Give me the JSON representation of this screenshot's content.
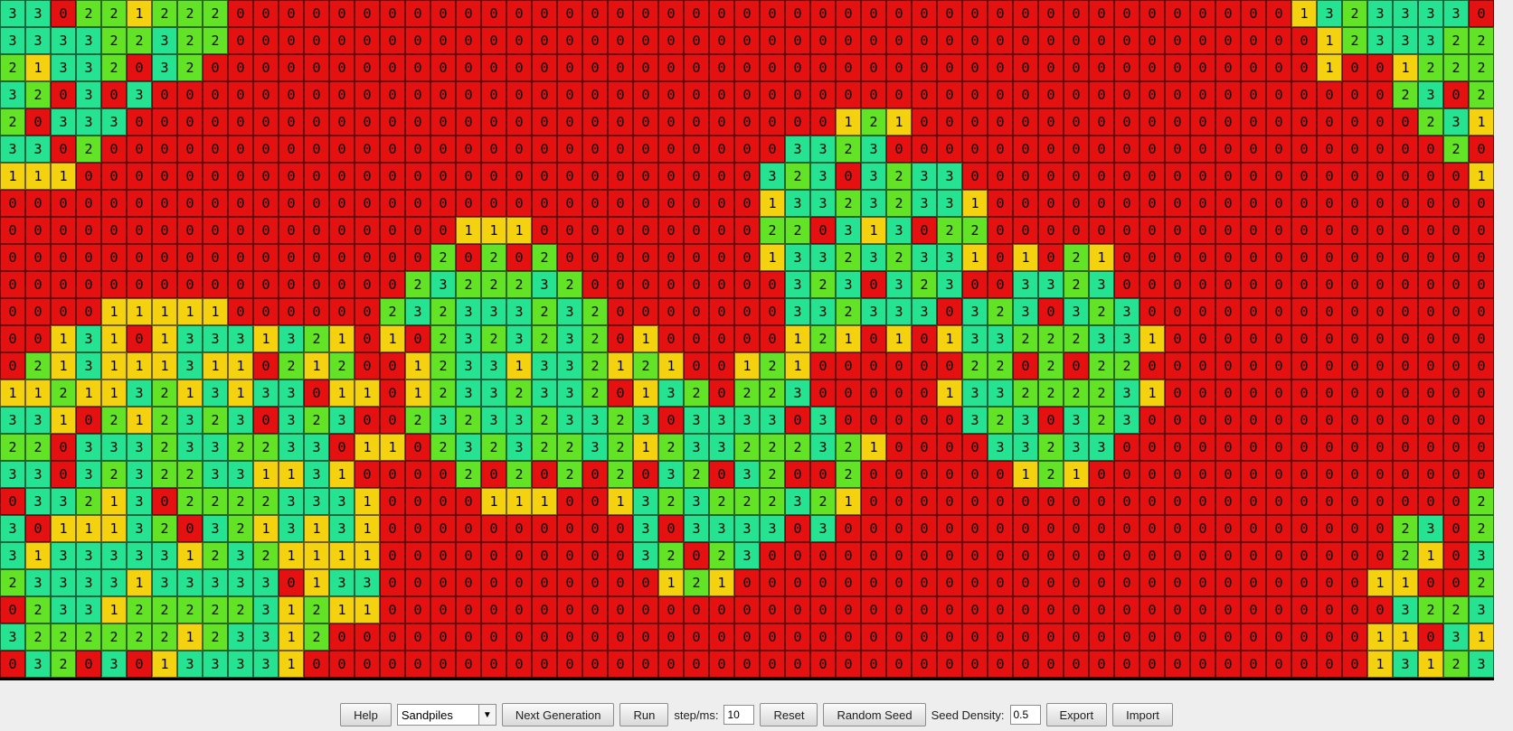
{
  "palette": {
    "0": "#e51010",
    "1": "#f5d20f",
    "2": "#62e325",
    "3": "#26e392"
  },
  "grid": {
    "rows": [
      "33022122200000000000000000000000000000000000000000013233330",
      "333322322000000000000000000000000000000000000000000012333223",
      "213320320000000000000000000000000000000000000000000010012223",
      "320303000000000000000000000000000000000000000000000000023023",
      "203330000000000000000000000000000121000000000000000000002313",
      "330200000000000000000000000000033230000000000000000000000202",
      "111000000000000000000000000000323032330000000000000000000011",
      "000000000000000000000000000000133232331000000000000000000000",
      "000000000000000000111000000000220313022000000000000000000000",
      "000000000000000002020200000000133232331010210000000000000000",
      "000000000000000023222320000000032303230033230000000000000000",
      "000011111000000232333232000000033233303230323000000000000000",
      "001310133313210102323232010000012101013322233100000000000000",
      "021311131102120012331332121001210000002202022000000000000000",
      "112113213133011012332332013202230000013322223100000000000000",
      "331021232303230023233233230333303000003230323000000000000000",
      "220333233223301102323223212332223210000332330000000000000001",
      "330323223311310000202020203203200200000012100000000000000003",
      "033213022223331000011100132322232100000000000000000000000022",
      "301113203213131000000000030333303000000000000000000000023023",
      "313333312321111000000000032023000000000000000000000000021033",
      "233331333330133000000000001210000000000000000000000000110022",
      "023312222231211000000000000000000000000000000000000000032232",
      "322222212331200000000000000000000000000000000000000000110312",
      "032030133331000000000000000000000000000000000000000000131232"
    ]
  },
  "controls": {
    "help_label": "Help",
    "mode_value": "Sandpiles",
    "next_generation_label": "Next Generation",
    "run_label": "Run",
    "step_label": "step/ms:",
    "step_value": "10",
    "reset_label": "Reset",
    "random_seed_label": "Random Seed",
    "seed_density_label": "Seed Density:",
    "seed_density_value": "0.5",
    "export_label": "Export",
    "import_label": "Import"
  }
}
